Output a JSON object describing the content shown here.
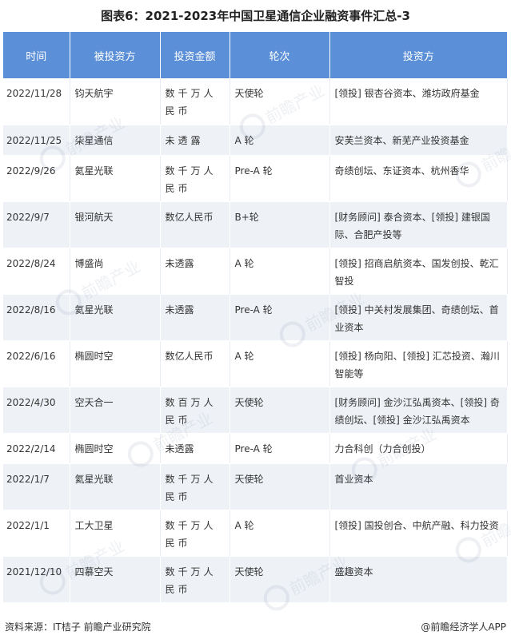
{
  "title": "图表6：2021-2023年中国卫星通信企业融资事件汇总-3",
  "table": {
    "headers": [
      "时间",
      "被投资方",
      "投资金额",
      "轮次",
      "投资方"
    ],
    "rows": [
      {
        "date": "2022/11/28",
        "company": "钧天航宇",
        "amount": "数千万人民币",
        "round": "天使轮",
        "investors": "[领投] 银杏谷资本、潍坊政府基金"
      },
      {
        "date": "2022/11/25",
        "company": "柒星通信",
        "amount": "未透露",
        "round": "A 轮",
        "investors": "安芙兰资本、新芜产业投资基金"
      },
      {
        "date": "2022/9/26",
        "company": "氦星光联",
        "amount": "数千万人民币",
        "round": "Pre-A 轮",
        "investors": "奇绩创坛、东证资本、杭州香华"
      },
      {
        "date": "2022/9/7",
        "company": "银河航天",
        "amount": "数亿人民币",
        "round": "B+轮",
        "investors": "[财务顾问] 泰合资本、[领投] 建银国际、合肥产投等"
      },
      {
        "date": "2022/8/24",
        "company": "博盛尚",
        "amount": "未透露",
        "round": "A 轮",
        "investors": "[领投] 招商启航资本、国发创投、乾汇智投"
      },
      {
        "date": "2022/8/16",
        "company": "氦星光联",
        "amount": "未透露",
        "round": "Pre-A 轮",
        "investors": "[领投] 中关村发展集团、奇绩创坛、首业资本"
      },
      {
        "date": "2022/6/16",
        "company": "椭圆时空",
        "amount": "数亿人民币",
        "round": "A 轮",
        "investors": "[领投] 杨向阳、[领投] 汇芯投资、瀚川智能等"
      },
      {
        "date": "2022/4/30",
        "company": "空天合一",
        "amount": "数百万人民币",
        "round": "天使轮",
        "investors": "[财务顾问] 金沙江弘禹资本、[领投] 奇绩创坛、[领投] 金沙江弘禹资本"
      },
      {
        "date": "2022/2/14",
        "company": "椭圆时空",
        "amount": "未透露",
        "round": "Pre-A 轮",
        "investors": "力合科创（力合创投）"
      },
      {
        "date": "2022/1/7",
        "company": "氦星光联",
        "amount": "数千万人民币",
        "round": "天使轮",
        "investors": "首业资本"
      },
      {
        "date": "2022/1/1",
        "company": "工大卫星",
        "amount": "数千万人民币",
        "round": "A 轮",
        "investors": "[领投] 国投创合、中航产融、科力投资"
      },
      {
        "date": "2021/12/10",
        "company": "四慕空天",
        "amount": "数千万人民币",
        "round": "天使轮",
        "investors": "盛趣资本"
      }
    ]
  },
  "footer": {
    "source": "资料来源：IT桔子 前瞻产业研究院",
    "brand": "@前瞻经济学人APP"
  },
  "watermark_text": "前瞻产业研究院",
  "colors": {
    "header_bg": "#5b8fd8",
    "stripe_bg": "#eef1f6"
  }
}
